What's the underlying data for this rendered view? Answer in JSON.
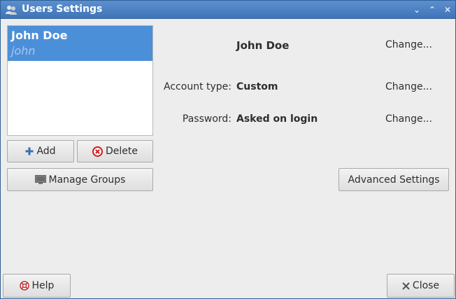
{
  "window": {
    "title": "Users Settings",
    "minimize_glyph": "⌄",
    "maximize_glyph": "⌃",
    "close_glyph": "✕"
  },
  "users": [
    {
      "name": "John Doe",
      "login": "john"
    }
  ],
  "buttons": {
    "add": "Add",
    "delete": "Delete",
    "manage_groups": "Manage Groups",
    "advanced_settings": "Advanced Settings",
    "help": "Help",
    "close": "Close"
  },
  "details": {
    "display_name": "John Doe",
    "account_type_label": "Account type:",
    "account_type_value": "Custom",
    "password_label": "Password:",
    "password_value": "Asked on login",
    "change_label": "Change..."
  },
  "icons": {
    "title": "users-icon",
    "add": "plus-icon",
    "delete": "delete-icon",
    "groups": "groups-icon",
    "help": "help-icon",
    "close": "close-icon"
  },
  "colors": {
    "titlebar": "#3f74b8",
    "selection": "#4b8fd9",
    "add_icon": "#3a6fb3",
    "delete_icon": "#d01919"
  }
}
